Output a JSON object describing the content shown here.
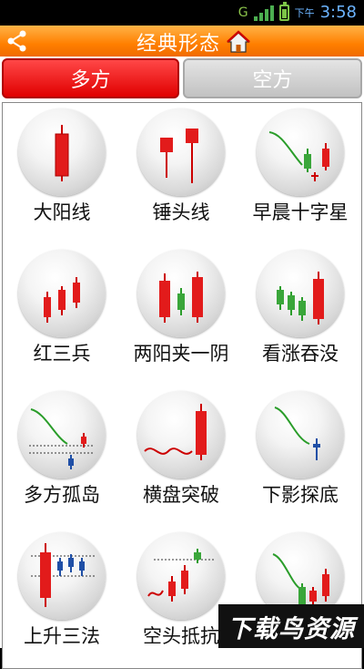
{
  "status": {
    "network": "G",
    "ampm": "下午",
    "time": "3:58"
  },
  "header": {
    "title": "经典形态"
  },
  "tabs": [
    {
      "label": "多方"
    },
    {
      "label": "空方"
    }
  ],
  "patterns": [
    {
      "label": "大阳线"
    },
    {
      "label": "锤头线"
    },
    {
      "label": "早晨十字星"
    },
    {
      "label": "红三兵"
    },
    {
      "label": "两阳夹一阴"
    },
    {
      "label": "看涨吞没"
    },
    {
      "label": "多方孤岛"
    },
    {
      "label": "横盘突破"
    },
    {
      "label": "下影探底"
    },
    {
      "label": "上升三法"
    },
    {
      "label": "空头抵抗"
    },
    {
      "label": ""
    }
  ],
  "colors": {
    "accent": "#ff7f00",
    "up": "#e21b1b",
    "down": "#1f4fa6",
    "green": "#3aa63a"
  },
  "watermark": "下载鸟资源"
}
